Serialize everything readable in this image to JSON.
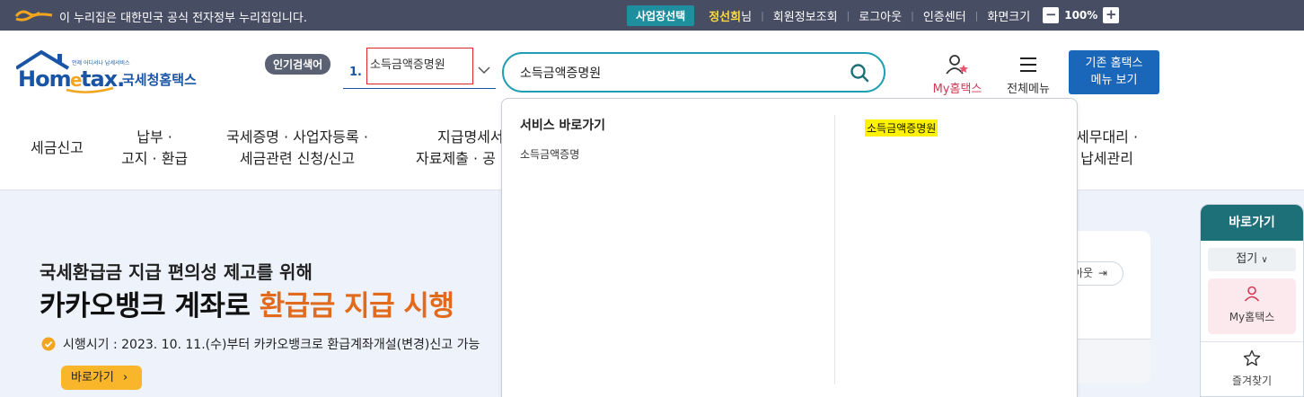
{
  "gov_banner": {
    "text": "이 누리집은 대한민국 공식 전자정부 누리집입니다.",
    "business_select": "사업장선택",
    "user_name": "정선희",
    "user_suffix": "님",
    "links": [
      "회원정보조회",
      "로그아웃",
      "인증센터",
      "화면크기"
    ],
    "zoom_minus": "−",
    "zoom_level": "100%",
    "zoom_plus": "+"
  },
  "header": {
    "logo_text": "Hometax",
    "logo_small": "언제 어디서나 납세서비스",
    "logo_kr": "국세청홈택스",
    "popular_label": "인기검색어",
    "popular_rank": "1.",
    "popular_term": "소득금액증명원",
    "search_value": "소득금액증명원",
    "my_hometax": "My홈택스",
    "all_menu": "전체메뉴",
    "old_hometax": [
      "기존 홈택스",
      "메뉴 보기"
    ]
  },
  "gnb": {
    "items": [
      [
        "세금신고"
      ],
      [
        "납부 ·",
        "고지 · 환급"
      ],
      [
        "국세증명 · 사업자등록 ·",
        "세금관련 신청/신고"
      ],
      [
        "지급명세서",
        "자료제출 · 공"
      ],
      [
        "세무대리 ·",
        "납세관리"
      ]
    ]
  },
  "hero": {
    "subtitle": "국세환급금 지급 편의성 제고를 위해",
    "title_plain": "카카오뱅크 계좌로 ",
    "title_accent": "환급금 지급 시행",
    "note": "시행시기 : 2023. 10. 11.(수)부터 카카오뱅크로 환급계좌개설(변경)신고 가능",
    "button": "바로가기",
    "card_logout": "아웃"
  },
  "quick_panel": {
    "title": "바로가기",
    "fold": "접기",
    "my_hometax": "My홈택스",
    "favorites": "즐겨찾기"
  },
  "autocomplete": {
    "section_title": "서비스 바로가기",
    "result_item": "소득금액증명",
    "highlight_item": "소득금액증명원"
  },
  "colors": {
    "banner_bg": "#474e63",
    "accent_teal": "#1d6f78",
    "search_border": "#1f9fb1",
    "brand_blue": "#1a55a5",
    "hero_accent": "#e26a1c",
    "highlight": "#fff200"
  }
}
